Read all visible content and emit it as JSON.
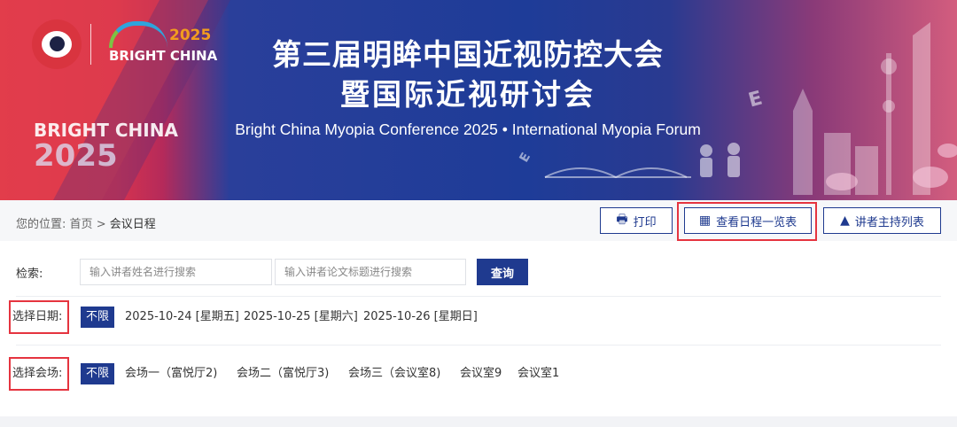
{
  "banner": {
    "logo_year": "2025",
    "logo_name": "BRIGHT CHINA",
    "side_line1": "BRIGHT CHINA",
    "side_line2": "2025",
    "title_line1": "第三届明眸中国近视防控大会",
    "title_line2": "暨国际近视研讨会",
    "subtitle": "Bright China Myopia Conference 2025 • International Myopia Forum",
    "decor_letter": "E"
  },
  "breadcrumb": {
    "prefix": "您的位置:",
    "home": "首页",
    "separator": ">",
    "current": "会议日程"
  },
  "toolbar": {
    "print_label": "打印",
    "view_schedule_label": "查看日程一览表",
    "speakers_label": "讲者主持列表"
  },
  "search": {
    "label": "检索:",
    "speaker_placeholder": "输入讲者姓名进行搜索",
    "paper_placeholder": "输入讲者论文标题进行搜索",
    "button_label": "查询"
  },
  "date_filter": {
    "label": "选择日期:",
    "options": [
      "不限",
      "2025-10-24 [星期五]",
      "2025-10-25 [星期六]",
      "2025-10-26 [星期日]"
    ],
    "selected": "不限"
  },
  "venue_filter": {
    "label": "选择会场:",
    "options": [
      "不限",
      "会场一（富悦厅2)",
      "会场二（富悦厅3)",
      "会场三（会议室8)",
      "会议室9",
      "会议室1"
    ],
    "selected": "不限"
  },
  "colors": {
    "primary": "#1f3a8f",
    "highlight": "#e5343f",
    "banner_red": "#e23a4b",
    "banner_blue": "#1e3c98"
  }
}
